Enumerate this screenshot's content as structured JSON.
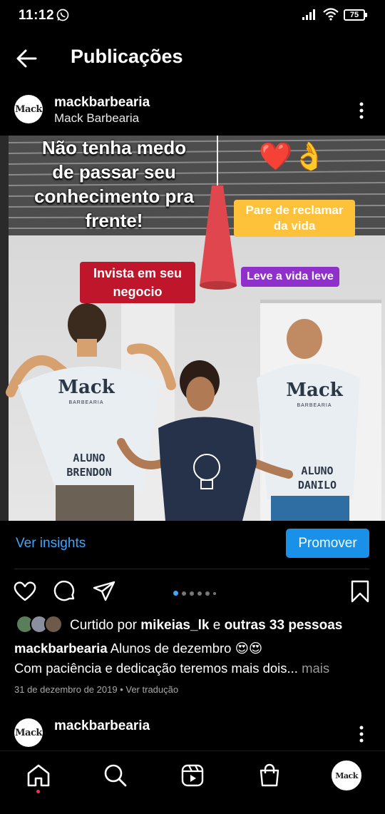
{
  "status_bar": {
    "time": "11:12",
    "battery": "75"
  },
  "header": {
    "title": "Publicações"
  },
  "post": {
    "username": "mackbarbearia",
    "display_name": "Mack Barbearia",
    "avatar_logo": "Mack",
    "image": {
      "top_text": [
        "Não tenha medo",
        "de passar seu",
        "conhecimento pra",
        "frente!"
      ],
      "sticker_reclamar": [
        "Pare de reclamar",
        "da vida"
      ],
      "sticker_invista": [
        "Invista em seu",
        "negocio"
      ],
      "sticker_leve": "Leve a vida leve",
      "shirt_brand": "Mack",
      "shirt_sub": "BARBEARIA",
      "shirt_left_name": [
        "ALUNO",
        "BRENDON"
      ],
      "shirt_right_name": [
        "ALUNO",
        "DANILO"
      ]
    },
    "insights_label": "Ver insights",
    "promote_label": "Promover",
    "likes_prefix": "Curtido por",
    "likes_user": "mikeias_lk",
    "likes_mid": "e",
    "likes_rest": "outras 33 pessoas",
    "caption_user": "mackbarbearia",
    "caption_text": "Alunos de dezembro 😍😍",
    "caption_line2": "Com paciência e dedicação teremos mais dois...",
    "caption_more": "mais",
    "date": "31 de dezembro de 2019",
    "separator": "•",
    "translate_label": "Ver tradução"
  },
  "next_post": {
    "username": "mackbarbearia"
  },
  "colors": {
    "accent": "#3ea6ff",
    "promote": "#1a91e8",
    "notification": "#ff3040"
  },
  "icons": [
    "back-arrow-icon",
    "more-icon",
    "heart-icon",
    "comment-icon",
    "share-icon",
    "save-icon",
    "home-icon",
    "search-icon",
    "reels-icon",
    "shop-icon",
    "profile-icon",
    "whatsapp-icon",
    "signal-icon",
    "wifi-icon"
  ]
}
